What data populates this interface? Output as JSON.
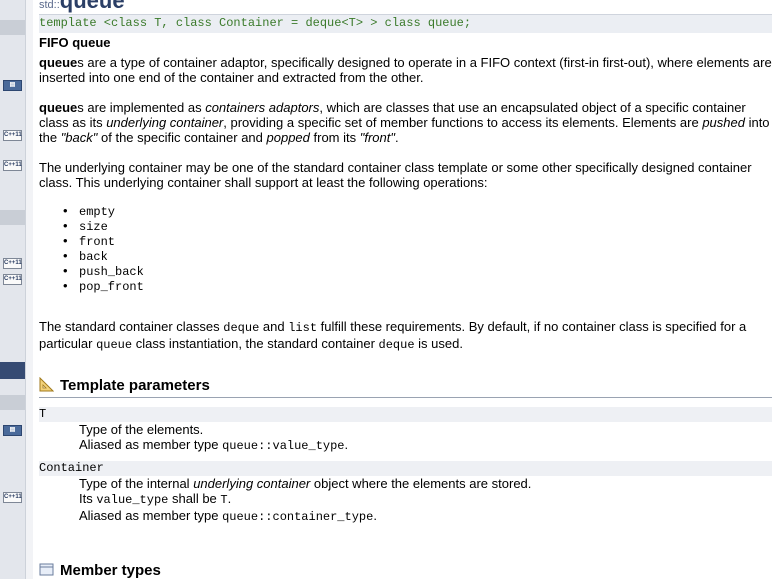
{
  "page": {
    "namespace": "std::",
    "title": "queue",
    "prototype": "template <class T, class Container = deque<T> > class queue;",
    "subtitle": "FIFO queue"
  },
  "intro": {
    "p1_bold": "queue",
    "p1_rest": "s are a type of container adaptor, specifically designed to operate in a FIFO context (first-in first-out), where elements are inserted into one end of the container and extracted from the other.",
    "p2_bold": "queue",
    "p2_a": "s are implemented as ",
    "p2_em1": "containers adaptors",
    "p2_b": ", which are classes that use an encapsulated object of a specific container class as its ",
    "p2_em2": "underlying container",
    "p2_c": ", providing a specific set of member functions to access its elements. Elements are ",
    "p2_em3": "pushed",
    "p2_d": " into the ",
    "p2_em4": "\"back\"",
    "p2_e": " of the specific container and ",
    "p2_em5": "popped",
    "p2_f": " from its ",
    "p2_em6": "\"front\"",
    "p2_g": ".",
    "p3": "The underlying container may be one of the standard container class template or some other specifically designed container class. This underlying container shall support at least the following operations:"
  },
  "operations": [
    "empty",
    "size",
    "front",
    "back",
    "push_back",
    "pop_front"
  ],
  "requirements": {
    "a": "The standard container classes ",
    "code1": "deque",
    "b": " and ",
    "code2": "list",
    "c": " fulfill these requirements. By default, if no container class is specified for a particular ",
    "code3": "queue",
    "d": " class instantiation, the standard container ",
    "code4": "deque",
    "e": " is used."
  },
  "template_params": {
    "heading": "Template parameters",
    "T": {
      "name": "T",
      "line1": "Type of the elements.",
      "line2_a": "Aliased as member type ",
      "line2_code": "queue::value_type",
      "line2_b": "."
    },
    "Container": {
      "name": "Container",
      "line1_a": "Type of the internal ",
      "line1_em": "underlying container",
      "line1_b": " object where the elements are stored.",
      "line2_a": "Its ",
      "line2_code1": "value_type",
      "line2_b": " shall be ",
      "line2_code2": "T",
      "line2_c": ".",
      "line3_a": "Aliased as member type ",
      "line3_code": "queue::container_type",
      "line3_b": "."
    }
  },
  "member_types": {
    "heading": "Member types"
  },
  "sidebar": {
    "icons": [
      "ref-icon",
      "cpp11-badge",
      "cpp11-badge",
      "cpp11-badge",
      "cpp11-badge",
      "ref-icon",
      "cpp11-badge"
    ],
    "cpp11_label": "C++11"
  },
  "colors": {
    "prototype_text": "#3a7a2a",
    "title": "#2b3f66",
    "sidebar_dark": "#364b73"
  }
}
